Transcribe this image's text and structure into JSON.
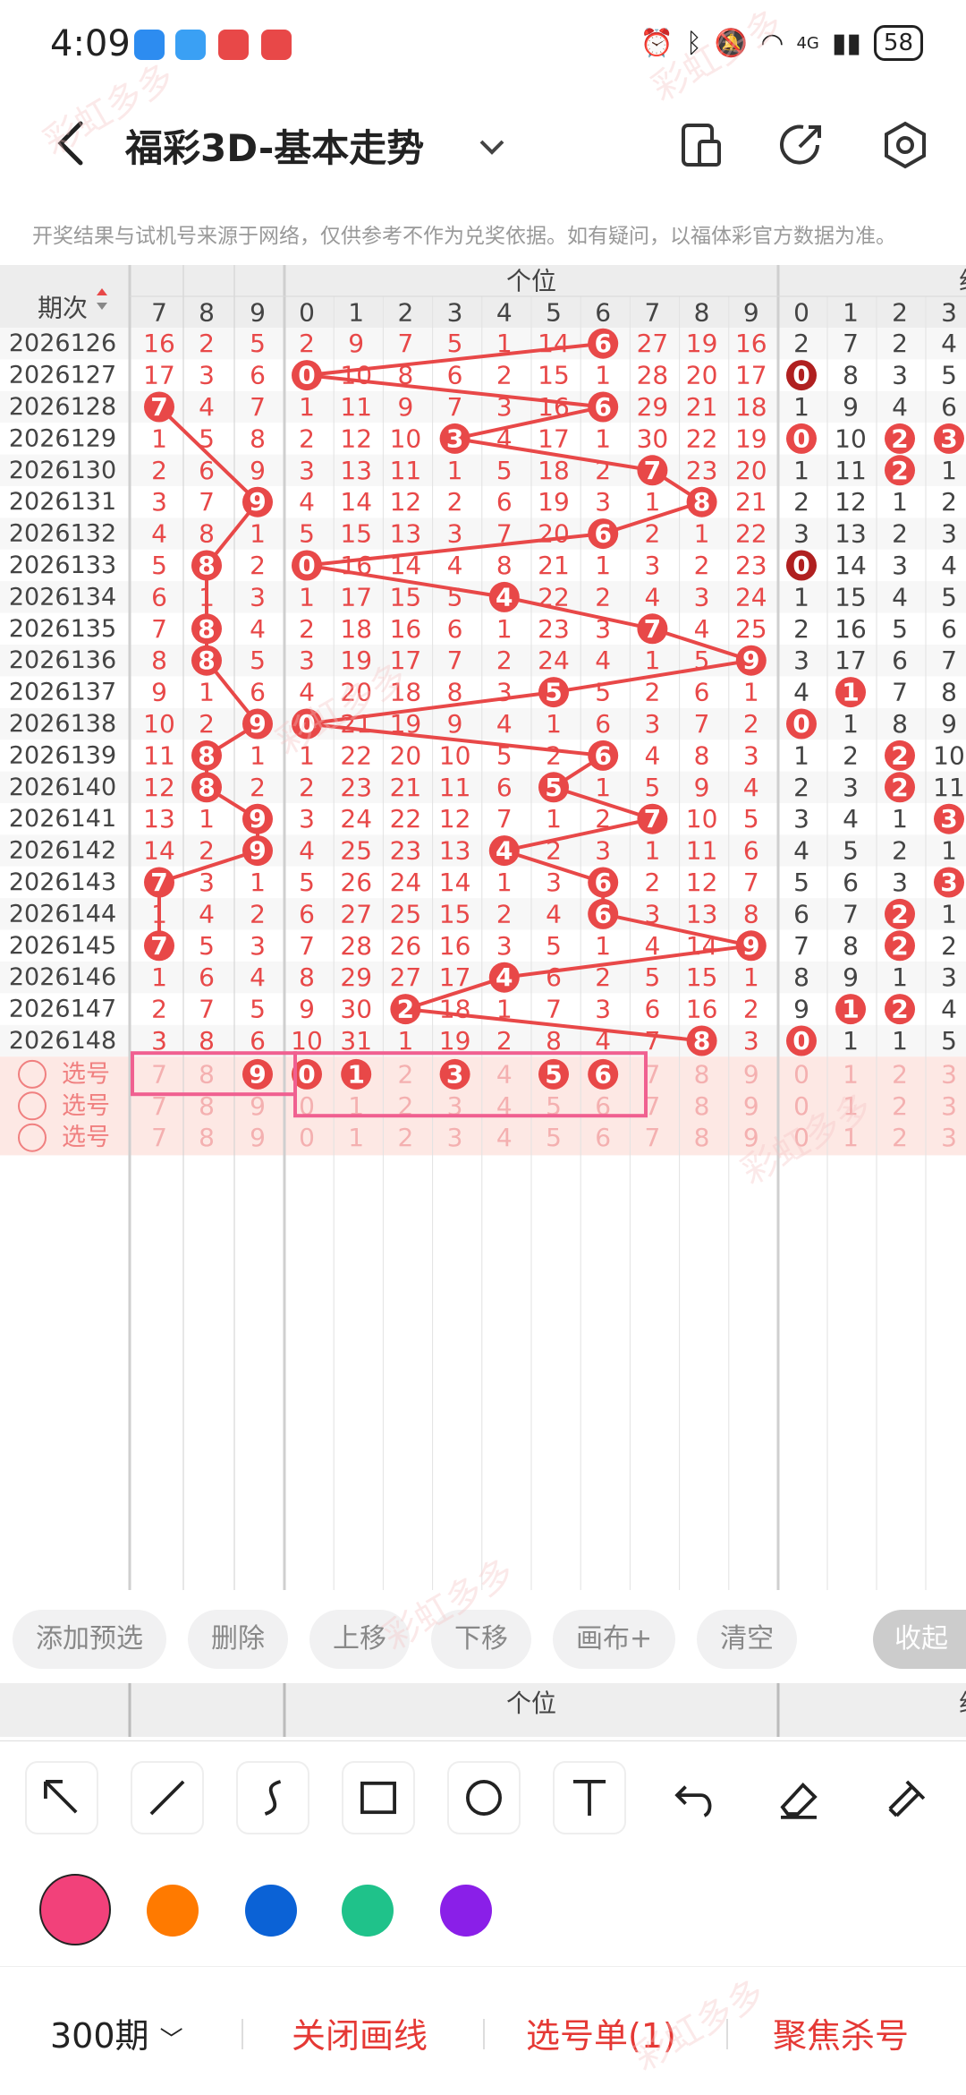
{
  "status_bar": {
    "time": "4:09",
    "network": "4G",
    "battery": "58"
  },
  "header": {
    "title": "福彩3D-基本走势"
  },
  "notice": "开奖结果与试机号来源于网络，仅供参考不作为兑奖依据。如有疑问，以福体彩官方数据为准。",
  "table": {
    "period_header": "期次",
    "section_ones": "个位",
    "section_group": "组",
    "left_digits": [
      "7",
      "8",
      "9"
    ],
    "ones_digits": [
      "0",
      "1",
      "2",
      "3",
      "4",
      "5",
      "6",
      "7",
      "8",
      "9"
    ],
    "group_digits": [
      "0",
      "1",
      "2",
      "3"
    ],
    "rows": [
      {
        "period": "2026126",
        "left": [
          "16",
          "2",
          "5"
        ],
        "ones": [
          "2",
          "9",
          "7",
          "5",
          "1",
          "14",
          "6",
          "27",
          "19",
          "16"
        ],
        "win": 6,
        "group": [
          "2",
          "7",
          "2",
          "4"
        ],
        "g_hit": []
      },
      {
        "period": "2026127",
        "left": [
          "17",
          "3",
          "6"
        ],
        "ones": [
          "0",
          "10",
          "8",
          "6",
          "2",
          "15",
          "1",
          "28",
          "20",
          "17"
        ],
        "win": 0,
        "group": [
          "0",
          "8",
          "3",
          "5"
        ],
        "g_hit": [
          0
        ],
        "g_dark": [
          0
        ]
      },
      {
        "period": "2026128",
        "left": [
          "7",
          "4",
          "7"
        ],
        "ones": [
          "1",
          "11",
          "9",
          "7",
          "3",
          "16",
          "6",
          "29",
          "21",
          "18"
        ],
        "win": 6,
        "left_hit": 0,
        "group": [
          "1",
          "9",
          "4",
          "6"
        ],
        "g_hit": []
      },
      {
        "period": "2026129",
        "left": [
          "1",
          "5",
          "8"
        ],
        "ones": [
          "2",
          "12",
          "10",
          "3",
          "4",
          "17",
          "1",
          "30",
          "22",
          "19"
        ],
        "win": 3,
        "group": [
          "0",
          "10",
          "2",
          "3"
        ],
        "g_hit": [
          0,
          2,
          3
        ]
      },
      {
        "period": "2026130",
        "left": [
          "2",
          "6",
          "9"
        ],
        "ones": [
          "3",
          "13",
          "11",
          "1",
          "5",
          "18",
          "2",
          "7",
          "23",
          "20"
        ],
        "win": 7,
        "group": [
          "1",
          "11",
          "2",
          "1"
        ],
        "g_hit": [
          2
        ]
      },
      {
        "period": "2026131",
        "left": [
          "3",
          "7",
          "9"
        ],
        "ones": [
          "4",
          "14",
          "12",
          "2",
          "6",
          "19",
          "3",
          "1",
          "8",
          "21"
        ],
        "win": 8,
        "left_hit": 2,
        "group": [
          "2",
          "12",
          "1",
          "2"
        ],
        "g_hit": []
      },
      {
        "period": "2026132",
        "left": [
          "4",
          "8",
          "1"
        ],
        "ones": [
          "5",
          "15",
          "13",
          "3",
          "7",
          "20",
          "6",
          "2",
          "1",
          "22"
        ],
        "win": 6,
        "group": [
          "3",
          "13",
          "2",
          "3"
        ],
        "g_hit": []
      },
      {
        "period": "2026133",
        "left": [
          "5",
          "8",
          "2"
        ],
        "ones": [
          "0",
          "16",
          "14",
          "4",
          "8",
          "21",
          "1",
          "3",
          "2",
          "23"
        ],
        "win": 0,
        "left_hit": 1,
        "group": [
          "0",
          "14",
          "3",
          "4"
        ],
        "g_hit": [
          0
        ],
        "g_dark": [
          0
        ]
      },
      {
        "period": "2026134",
        "left": [
          "6",
          "1",
          "3"
        ],
        "ones": [
          "1",
          "17",
          "15",
          "5",
          "4",
          "22",
          "2",
          "4",
          "3",
          "24"
        ],
        "win": 4,
        "group": [
          "1",
          "15",
          "4",
          "5"
        ],
        "g_hit": []
      },
      {
        "period": "2026135",
        "left": [
          "7",
          "8",
          "4"
        ],
        "ones": [
          "2",
          "18",
          "16",
          "6",
          "1",
          "23",
          "3",
          "7",
          "4",
          "25"
        ],
        "win": 7,
        "left_hit": 1,
        "group": [
          "2",
          "16",
          "5",
          "6"
        ],
        "g_hit": []
      },
      {
        "period": "2026136",
        "left": [
          "8",
          "8",
          "5"
        ],
        "ones": [
          "3",
          "19",
          "17",
          "7",
          "2",
          "24",
          "4",
          "1",
          "5",
          "9"
        ],
        "win": 9,
        "left_hit": 1,
        "group": [
          "3",
          "17",
          "6",
          "7"
        ],
        "g_hit": []
      },
      {
        "period": "2026137",
        "left": [
          "9",
          "1",
          "6"
        ],
        "ones": [
          "4",
          "20",
          "18",
          "8",
          "3",
          "5",
          "5",
          "2",
          "6",
          "1"
        ],
        "win": 5,
        "group": [
          "4",
          "1",
          "7",
          "8"
        ],
        "g_hit": [
          1
        ]
      },
      {
        "period": "2026138",
        "left": [
          "10",
          "2",
          "9"
        ],
        "ones": [
          "0",
          "21",
          "19",
          "9",
          "4",
          "1",
          "6",
          "3",
          "7",
          "2"
        ],
        "win": 0,
        "left_hit": 2,
        "group": [
          "0",
          "1",
          "8",
          "9"
        ],
        "g_hit": [
          0
        ]
      },
      {
        "period": "2026139",
        "left": [
          "11",
          "8",
          "1"
        ],
        "ones": [
          "1",
          "22",
          "20",
          "10",
          "5",
          "2",
          "6",
          "4",
          "8",
          "3"
        ],
        "win": 6,
        "left_hit": 1,
        "group": [
          "1",
          "2",
          "2",
          "10"
        ],
        "g_hit": [
          2
        ]
      },
      {
        "period": "2026140",
        "left": [
          "12",
          "8",
          "2"
        ],
        "ones": [
          "2",
          "23",
          "21",
          "11",
          "6",
          "5",
          "1",
          "5",
          "9",
          "4"
        ],
        "win": 5,
        "left_hit": 1,
        "group": [
          "2",
          "3",
          "2",
          "11"
        ],
        "g_hit": [
          2
        ]
      },
      {
        "period": "2026141",
        "left": [
          "13",
          "1",
          "9"
        ],
        "ones": [
          "3",
          "24",
          "22",
          "12",
          "7",
          "1",
          "2",
          "7",
          "10",
          "5"
        ],
        "win": 7,
        "left_hit": 2,
        "group": [
          "3",
          "4",
          "1",
          "3"
        ],
        "g_hit": [
          3
        ]
      },
      {
        "period": "2026142",
        "left": [
          "14",
          "2",
          "9"
        ],
        "ones": [
          "4",
          "25",
          "23",
          "13",
          "4",
          "2",
          "3",
          "1",
          "11",
          "6"
        ],
        "win": 4,
        "left_hit": 2,
        "group": [
          "4",
          "5",
          "2",
          "1"
        ],
        "g_hit": []
      },
      {
        "period": "2026143",
        "left": [
          "7",
          "3",
          "1"
        ],
        "ones": [
          "5",
          "26",
          "24",
          "14",
          "1",
          "3",
          "6",
          "2",
          "12",
          "7"
        ],
        "win": 6,
        "left_hit": 0,
        "group": [
          "5",
          "6",
          "3",
          "3"
        ],
        "g_hit": [
          3
        ]
      },
      {
        "period": "2026144",
        "left": [
          "1",
          "4",
          "2"
        ],
        "ones": [
          "6",
          "27",
          "25",
          "15",
          "2",
          "4",
          "6",
          "3",
          "13",
          "8"
        ],
        "win": 6,
        "group": [
          "6",
          "7",
          "2",
          "1"
        ],
        "g_hit": [
          2
        ]
      },
      {
        "period": "2026145",
        "left": [
          "7",
          "5",
          "3"
        ],
        "ones": [
          "7",
          "28",
          "26",
          "16",
          "3",
          "5",
          "1",
          "4",
          "14",
          "9"
        ],
        "win": 9,
        "left_hit": 0,
        "group": [
          "7",
          "8",
          "2",
          "2"
        ],
        "g_hit": [
          2
        ]
      },
      {
        "period": "2026146",
        "left": [
          "1",
          "6",
          "4"
        ],
        "ones": [
          "8",
          "29",
          "27",
          "17",
          "4",
          "6",
          "2",
          "5",
          "15",
          "1"
        ],
        "win": 4,
        "group": [
          "8",
          "9",
          "1",
          "3"
        ],
        "g_hit": []
      },
      {
        "period": "2026147",
        "left": [
          "2",
          "7",
          "5"
        ],
        "ones": [
          "9",
          "30",
          "2",
          "18",
          "1",
          "7",
          "3",
          "6",
          "16",
          "2"
        ],
        "win": 2,
        "group": [
          "9",
          "1",
          "2",
          "4"
        ],
        "g_hit": [
          1,
          2
        ]
      },
      {
        "period": "2026148",
        "left": [
          "3",
          "8",
          "6"
        ],
        "ones": [
          "10",
          "31",
          "1",
          "19",
          "2",
          "8",
          "4",
          "7",
          "8",
          "3"
        ],
        "win": 8,
        "group": [
          "0",
          "1",
          "1",
          "5"
        ],
        "g_hit": [
          0
        ]
      }
    ],
    "select_label": "选号",
    "select_rows": [
      {
        "left_sel": [
          2
        ],
        "ones_sel": [
          0,
          1,
          3,
          5,
          6
        ]
      },
      {
        "left_sel": [],
        "ones_sel": []
      },
      {
        "left_sel": [],
        "ones_sel": []
      }
    ]
  },
  "toolbar": {
    "buttons": [
      "添加预选",
      "删除",
      "上移",
      "下移",
      "画布+",
      "清空"
    ],
    "collapse": "收起"
  },
  "draw_tools": [
    "arrow-icon",
    "line-icon",
    "curve-icon",
    "rectangle-icon",
    "circle-icon",
    "text-icon",
    "undo-icon",
    "eraser-icon",
    "clear-icon"
  ],
  "colors": [
    "#f2417a",
    "#ff7a00",
    "#0b62d6",
    "#1fc28a",
    "#8a1fe8"
  ],
  "bottom": {
    "periods": "300期",
    "close_draw": "关闭画线",
    "selection": "选号单(1)",
    "focus": "聚焦杀号"
  },
  "watermark": "彩虹多多",
  "theme": {
    "red": "#e84848",
    "dark_red": "#b02020",
    "pink_box": "#f06090"
  }
}
